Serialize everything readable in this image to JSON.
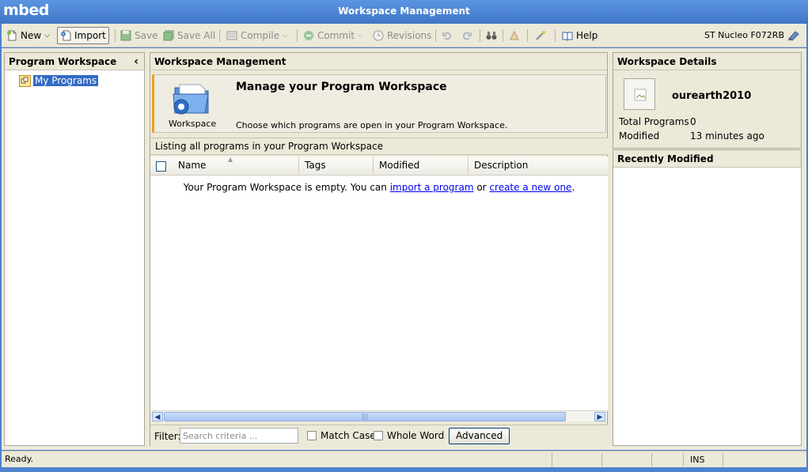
{
  "app": {
    "logo": "mbed",
    "window_title": "Workspace Management"
  },
  "toolbar": {
    "new_label": "New",
    "import_label": "Import",
    "save_label": "Save",
    "save_all_label": "Save All",
    "compile_label": "Compile",
    "commit_label": "Commit",
    "revisions_label": "Revisions",
    "help_label": "Help",
    "device_label": "ST Nucleo F072RB"
  },
  "left_panel": {
    "title": "Program Workspace",
    "tree": [
      {
        "label": "My Programs",
        "icon": "programs-folder-icon",
        "selected": true
      }
    ]
  },
  "center_panel": {
    "title": "Workspace Management",
    "banner": {
      "icon_label": "Workspace",
      "title": "Manage your Program Workspace",
      "description": "Choose which programs are open in your Program Workspace."
    },
    "listing_caption": "Listing all programs in your Program Workspace",
    "columns": [
      "Name",
      "Tags",
      "Modified",
      "Description"
    ],
    "empty": {
      "prefix": "Your Program Workspace is empty. You can ",
      "import_link": "import a program",
      "middle": " or ",
      "create_link": "create a new one",
      "suffix": "."
    },
    "filter": {
      "label": "Filter:",
      "placeholder": "Search criteria ...",
      "match_case": "Match Case",
      "whole_word": "Whole Word",
      "advanced": "Advanced"
    }
  },
  "right_panel": {
    "details_title": "Workspace Details",
    "username": "ourearth2010",
    "stats": [
      {
        "label": "Total Programs",
        "value": "0"
      },
      {
        "label": "Modified",
        "value": "13 minutes ago"
      }
    ],
    "recent_title": "Recently Modified"
  },
  "status": {
    "text": "Ready.",
    "mode": "INS"
  },
  "colors": {
    "titlebar": "#4d82cf",
    "chrome": "#ece9d8",
    "selection": "#316ac5",
    "banner_accent": "#f0a020"
  }
}
